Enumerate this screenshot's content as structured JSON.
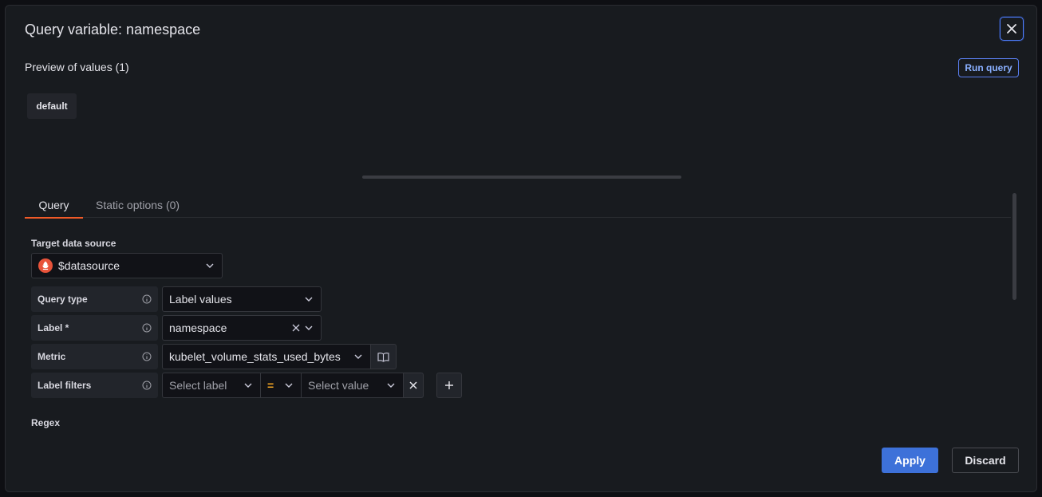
{
  "modal": {
    "title": "Query variable: namespace",
    "preview_title": "Preview of values (1)",
    "run_query_label": "Run query",
    "preview_values": [
      "default"
    ]
  },
  "tabs": [
    {
      "label": "Query",
      "active": true
    },
    {
      "label": "Static options (0)",
      "active": false
    }
  ],
  "form": {
    "target_ds_label": "Target data source",
    "datasource_value": "$datasource",
    "query_type_label": "Query type",
    "query_type_value": "Label values",
    "label_label": "Label *",
    "label_value": "namespace",
    "metric_label": "Metric",
    "metric_value": "kubelet_volume_stats_used_bytes",
    "label_filters_label": "Label filters",
    "select_label_placeholder": "Select label",
    "operator_value": "=",
    "select_value_placeholder": "Select value",
    "regex_label": "Regex"
  },
  "footer": {
    "apply_label": "Apply",
    "discard_label": "Discard"
  },
  "colors": {
    "accent_tab": "#f05a28",
    "primary_button": "#3d71d9",
    "link_blue": "#8ab0ff"
  }
}
